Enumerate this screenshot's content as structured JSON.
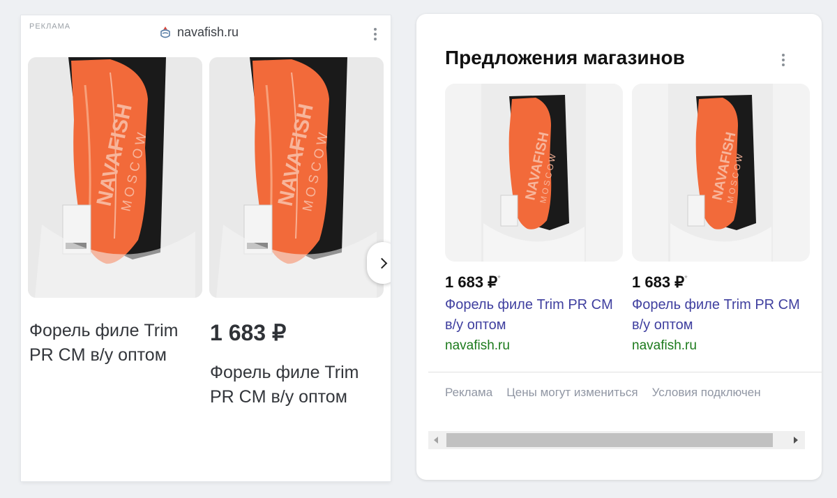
{
  "ad": {
    "label": "РЕКЛАМА",
    "domain": "navafish.ru",
    "favicon_icon": "navafish-logo-icon",
    "menu_icon": "more-vertical-icon",
    "images": [
      {
        "alt": "Форель филе",
        "brand": "NAVAFISH",
        "city": "MOSCOW"
      },
      {
        "alt": "Форель филе",
        "brand": "NAVAFISH",
        "city": "MOSCOW"
      }
    ],
    "next_icon": "chevron-right-icon",
    "product_title_left": "Форель филе Trim PR CM в/у оптом",
    "price": "1 683 ₽",
    "product_title_right": "Форель филе Trim PR CM в/у оптом"
  },
  "shop": {
    "title": "Предложения магазинов",
    "menu_icon": "more-vertical-icon",
    "offers": [
      {
        "price": "1 683 ₽",
        "price_mark": "*",
        "name": "Форель филе Trim PR CM в/у оптом",
        "site": "navafish.ru",
        "brand": "NAVAFISH",
        "city": "MOSCOW"
      },
      {
        "price": "1 683 ₽",
        "price_mark": "*",
        "name": "Форель филе Trim PR CM в/у оптом",
        "site": "navafish.ru",
        "brand": "NAVAFISH",
        "city": "MOSCOW"
      }
    ],
    "footer": [
      "Реклама",
      "Цены могут измениться",
      "Условия подключен"
    ]
  },
  "colors": {
    "fish": "#f26a3a",
    "tray": "#1a1a1a",
    "link": "#3f3f9f",
    "site": "#1c7a1c"
  }
}
